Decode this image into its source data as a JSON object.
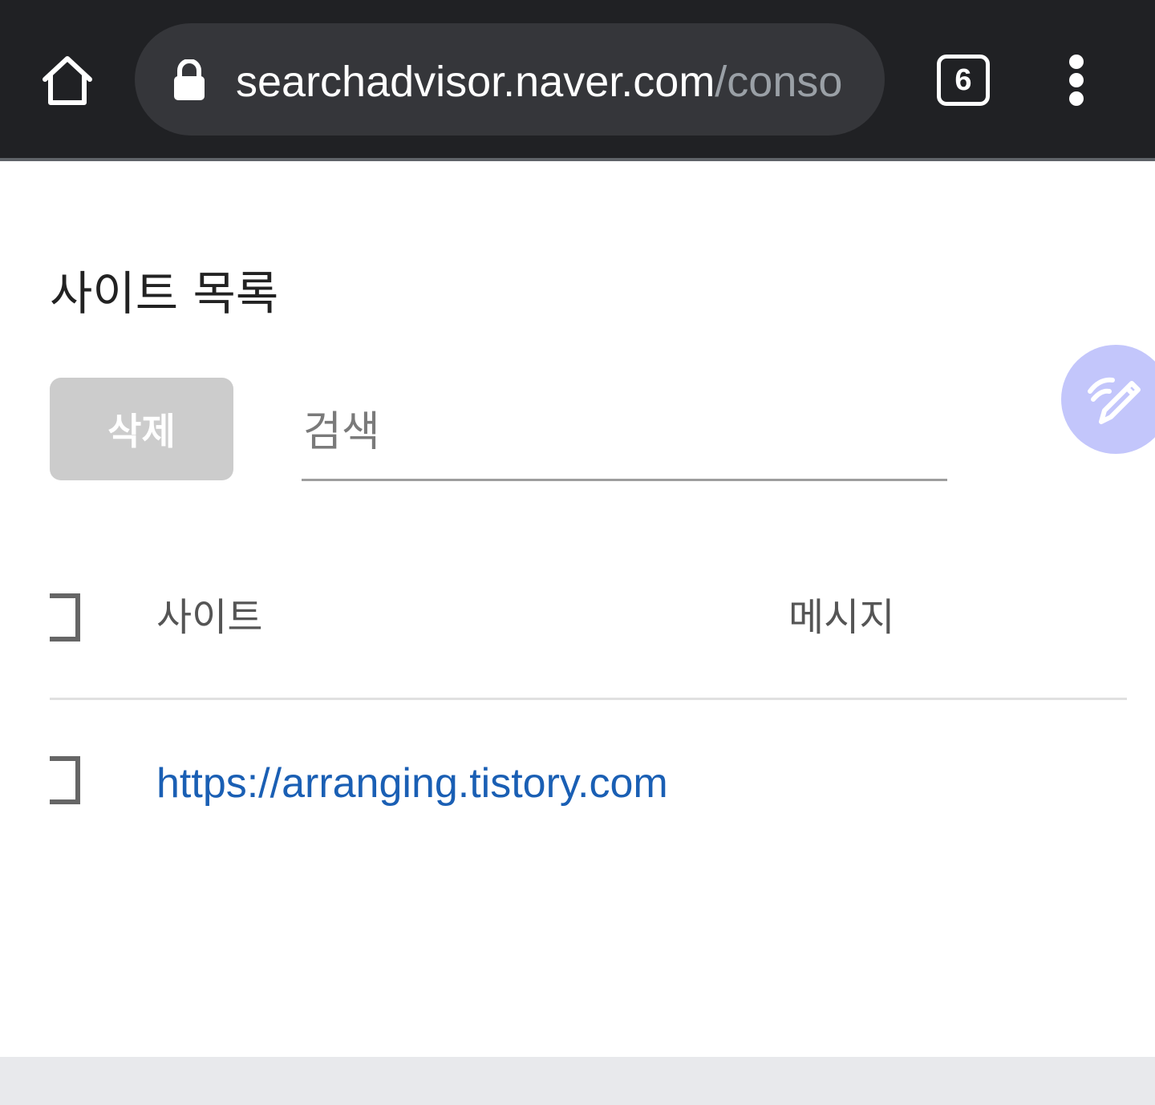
{
  "browser": {
    "url_host": "searchadvisor.naver.com",
    "url_path": "/conso",
    "tab_count": "6",
    "icons": {
      "home": "home-icon",
      "lock": "lock-icon",
      "menu": "more-vert-icon"
    }
  },
  "page": {
    "title": "사이트 목록",
    "delete_label": "삭제",
    "search_placeholder": "검색",
    "fab_icon": "pencil-icon"
  },
  "table": {
    "headers": {
      "site": "사이트",
      "message": "메시지"
    },
    "rows": [
      {
        "site": "https://arranging.tistory.com",
        "message": ""
      }
    ]
  },
  "colors": {
    "toolbar": "#202124",
    "omnibox": "#35363a",
    "link": "#1a5fb4",
    "button_disabled": "#cccccc",
    "fab": "#c3c6fb"
  }
}
